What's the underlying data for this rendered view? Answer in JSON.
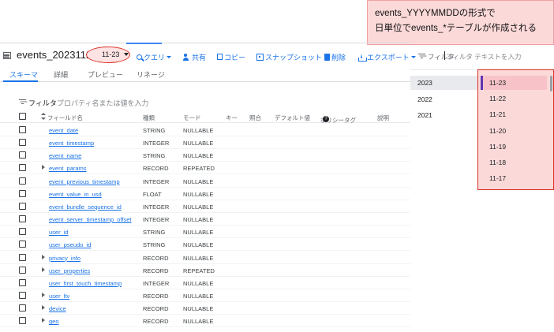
{
  "annotation": {
    "line1": "events_YYYYMMDDの形式で",
    "line2": "日単位でevents_*テーブルが作成される"
  },
  "header": {
    "table_name": "events_20231123",
    "date_selector": "11-23"
  },
  "toolbar": {
    "query": "クエリ",
    "share": "共有",
    "copy": "コピー",
    "snapshot": "スナップショット",
    "delete": "削除",
    "export": "エクスポート"
  },
  "tabs": [
    "スキーマ",
    "詳細",
    "プレビュー",
    "リネージ"
  ],
  "filter": {
    "label": "フィルタ",
    "placeholder": "プロパティ名または値を入力"
  },
  "columns": {
    "field_name": "フィールド名",
    "type": "種類",
    "mode": "モード",
    "key": "キー",
    "collation": "照合",
    "default": "デフォルト値",
    "policy_tag": "ポリシータグ",
    "description": "説明"
  },
  "fields": [
    {
      "name": "event_date",
      "type": "STRING",
      "mode": "NULLABLE",
      "expandable": false
    },
    {
      "name": "event_timestamp",
      "type": "INTEGER",
      "mode": "NULLABLE",
      "expandable": false
    },
    {
      "name": "event_name",
      "type": "STRING",
      "mode": "NULLABLE",
      "expandable": false
    },
    {
      "name": "event_params",
      "type": "RECORD",
      "mode": "REPEATED",
      "expandable": true
    },
    {
      "name": "event_previous_timestamp",
      "type": "INTEGER",
      "mode": "NULLABLE",
      "expandable": false
    },
    {
      "name": "event_value_in_usd",
      "type": "FLOAT",
      "mode": "NULLABLE",
      "expandable": false
    },
    {
      "name": "event_bundle_sequence_id",
      "type": "INTEGER",
      "mode": "NULLABLE",
      "expandable": false
    },
    {
      "name": "event_server_timestamp_offset",
      "type": "INTEGER",
      "mode": "NULLABLE",
      "expandable": false
    },
    {
      "name": "user_id",
      "type": "STRING",
      "mode": "NULLABLE",
      "expandable": false
    },
    {
      "name": "user_pseudo_id",
      "type": "STRING",
      "mode": "NULLABLE",
      "expandable": false
    },
    {
      "name": "privacy_info",
      "type": "RECORD",
      "mode": "NULLABLE",
      "expandable": true
    },
    {
      "name": "user_properties",
      "type": "RECORD",
      "mode": "REPEATED",
      "expandable": true
    },
    {
      "name": "user_first_touch_timestamp",
      "type": "INTEGER",
      "mode": "NULLABLE",
      "expandable": false
    },
    {
      "name": "user_ltv",
      "type": "RECORD",
      "mode": "NULLABLE",
      "expandable": true
    },
    {
      "name": "device",
      "type": "RECORD",
      "mode": "NULLABLE",
      "expandable": true
    },
    {
      "name": "geo",
      "type": "RECORD",
      "mode": "NULLABLE",
      "expandable": true
    }
  ],
  "partition_panel": {
    "filter_label": "フィルタ",
    "filter_placeholder": "フィルタ テキストを入力",
    "years": [
      "2023",
      "2022",
      "2021"
    ],
    "selected_year": "2023",
    "days": [
      "11-23",
      "11-22",
      "11-21",
      "11-20",
      "11-19",
      "11-18",
      "11-17"
    ],
    "selected_day": "11-23"
  }
}
